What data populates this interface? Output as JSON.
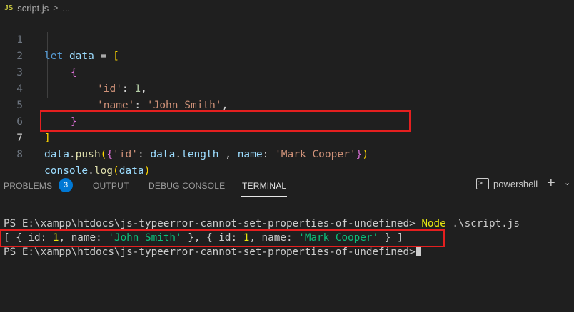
{
  "breadcrumb": {
    "file_icon": "JS",
    "file_name": "script.js",
    "separator": ">",
    "more": "..."
  },
  "editor": {
    "lines": [
      {
        "number": "1"
      },
      {
        "number": "2"
      },
      {
        "number": "3"
      },
      {
        "number": "4"
      },
      {
        "number": "5"
      },
      {
        "number": "6"
      },
      {
        "number": "7"
      },
      {
        "number": "8"
      }
    ],
    "tokens": {
      "l1_let": "let",
      "l1_data": "data",
      "l1_eq": " = ",
      "l1_bracket": "[",
      "l2_brace": "{",
      "l3_key": "'id'",
      "l3_colon": ": ",
      "l3_val": "1",
      "l3_comma": ",",
      "l4_key": "'name'",
      "l4_colon": ": ",
      "l4_val": "'John Smith'",
      "l4_comma": ",",
      "l5_brace": "}",
      "l6_bracket": "]",
      "l7_obj": "data",
      "l7_dot": ".",
      "l7_fn": "push",
      "l7_paren_open": "(",
      "l7_brace_open": "{",
      "l7_key1": "'id'",
      "l7_colon1": ": ",
      "l7_data": "data",
      "l7_dot2": ".",
      "l7_length": "length",
      "l7_sep": " , ",
      "l7_key2": "name",
      "l7_colon2": ": ",
      "l7_val2": "'Mark Cooper'",
      "l7_brace_close": "}",
      "l7_paren_close": ")",
      "l8_obj": "console",
      "l8_dot": ".",
      "l8_fn": "log",
      "l8_paren_open": "(",
      "l8_arg": "data",
      "l8_paren_close": ")"
    }
  },
  "panel": {
    "tabs": [
      {
        "label": "PROBLEMS"
      },
      {
        "label": "OUTPUT"
      },
      {
        "label": "DEBUG CONSOLE"
      },
      {
        "label": "TERMINAL",
        "active": true
      }
    ],
    "problems_count": "3",
    "shell_label": "powershell",
    "plus_glyph": "+",
    "chevron_glyph": "⌄"
  },
  "terminal": {
    "prompt": "PS E:\\xampp\\htdocs\\js-typeerror-cannot-set-properties-of-undefined> ",
    "command_name": "Node",
    "command_args": " .\\script.js",
    "output": {
      "p1": "[ { id: ",
      "n1": "1",
      "p2": ", name: ",
      "s1": "'John Smith'",
      "p3": " }, { id: ",
      "n2": "1",
      "p4": ", name: ",
      "s2": "'Mark Cooper'",
      "p5": " } ]"
    },
    "prompt2": "PS E:\\xampp\\htdocs\\js-typeerror-cannot-set-properties-of-undefined>"
  },
  "colors": {
    "highlight_box": "#e51f1f",
    "badge": "#0078d4",
    "background": "#1f1f1f"
  }
}
